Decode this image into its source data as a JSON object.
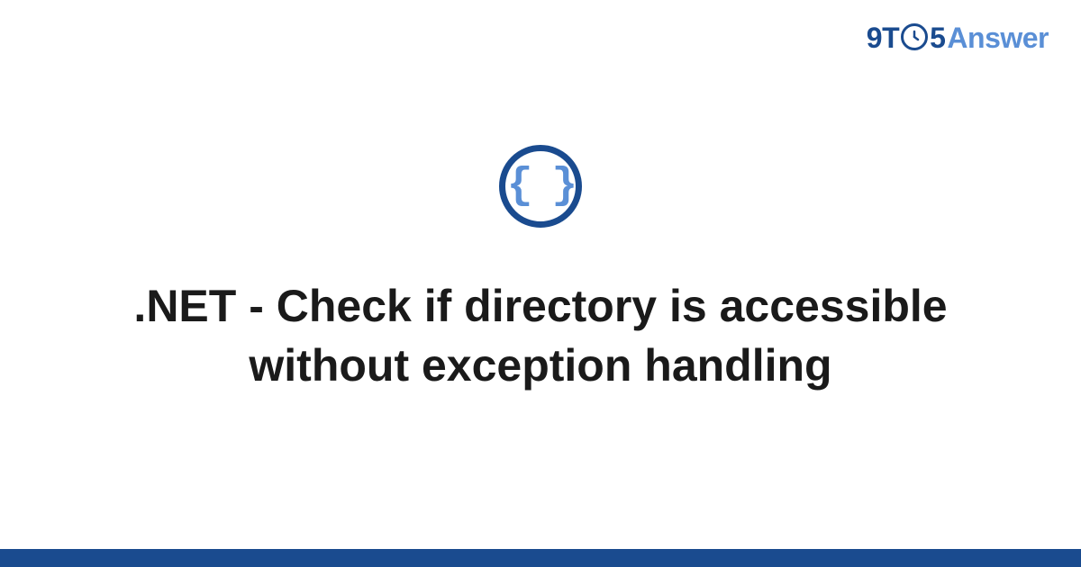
{
  "logo": {
    "prefix_9t": "9T",
    "clock_face": "II",
    "five": "5",
    "answer": "Answer"
  },
  "icon": {
    "braces": "{ }",
    "name": "code-braces-icon"
  },
  "title": ".NET - Check if directory is accessible without exception handling",
  "colors": {
    "brand_dark": "#1a4b8f",
    "brand_light": "#5a8fd6"
  }
}
